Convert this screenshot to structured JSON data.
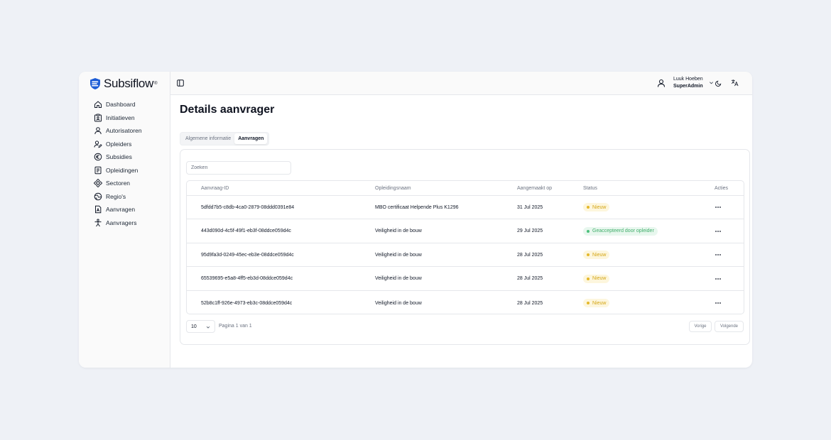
{
  "brand": {
    "name": "Subsiflow",
    "mark": "®",
    "color": "#1d5cd6"
  },
  "sidebar": {
    "items": [
      {
        "label": "Dashboard",
        "icon": "home-icon"
      },
      {
        "label": "Initiatieven",
        "icon": "clipboard-icon"
      },
      {
        "label": "Autorisatoren",
        "icon": "user-icon"
      },
      {
        "label": "Opleiders",
        "icon": "user-pen-icon"
      },
      {
        "label": "Subsidies",
        "icon": "euro-icon"
      },
      {
        "label": "Opleidingen",
        "icon": "document-icon"
      },
      {
        "label": "Sectoren",
        "icon": "network-icon"
      },
      {
        "label": "Regio's",
        "icon": "globe-icon"
      },
      {
        "label": "Aanvragen",
        "icon": "file-a-icon"
      },
      {
        "label": "Aanvragers",
        "icon": "person-icon"
      }
    ]
  },
  "topbar": {
    "user_name": "Luuk Hoeben",
    "user_role": "SuperAdmin"
  },
  "page": {
    "title": "Details aanvrager"
  },
  "tabs": [
    {
      "label": "Algemene informatie",
      "active": false
    },
    {
      "label": "Aanvragen",
      "active": true
    }
  ],
  "search": {
    "placeholder": "Zoeken",
    "value": ""
  },
  "table": {
    "columns": [
      "Aanvraag-ID",
      "Opleidingsnaam",
      "Aangemaakt op",
      "Status",
      "Acties"
    ],
    "rows": [
      {
        "id": "5dfdd7b5-c8db-4ca0-2879-08ddd0391e84",
        "name": "MBO certificaat Helpende Plus K1296",
        "date": "31 Jul 2025",
        "status": "Nieuw",
        "status_type": "new"
      },
      {
        "id": "443d090d-4c5f-49f1-eb3f-08ddce059d4c",
        "name": "Veiligheid in de bouw",
        "date": "29 Jul 2025",
        "status": "Geaccepteerd door opleider",
        "status_type": "accepted"
      },
      {
        "id": "95d9fa3d-0249-45ec-eb3e-08ddce059d4c",
        "name": "Veiligheid in de bouw",
        "date": "28 Jul 2025",
        "status": "Nieuw",
        "status_type": "new"
      },
      {
        "id": "65539695-e5a8-4ff5-eb3d-08ddce059d4c",
        "name": "Veiligheid in de bouw",
        "date": "28 Jul 2025",
        "status": "Nieuw",
        "status_type": "new"
      },
      {
        "id": "52b8c1ff-926e-4973-eb3c-08ddce059d4c",
        "name": "Veiligheid in de bouw",
        "date": "28 Jul 2025",
        "status": "Nieuw",
        "status_type": "new"
      }
    ]
  },
  "status_colors": {
    "new": {
      "text": "#d4a514",
      "bg": "#fdf6dd",
      "dot": "#e5b82a"
    },
    "accepted": {
      "text": "#3fae6a",
      "bg": "#e8f7ee",
      "dot": "#4cc07c"
    }
  },
  "pagination": {
    "page_size": "10",
    "info": "Pagina 1 van 1",
    "prev_label": "Vorige",
    "next_label": "Volgende"
  }
}
